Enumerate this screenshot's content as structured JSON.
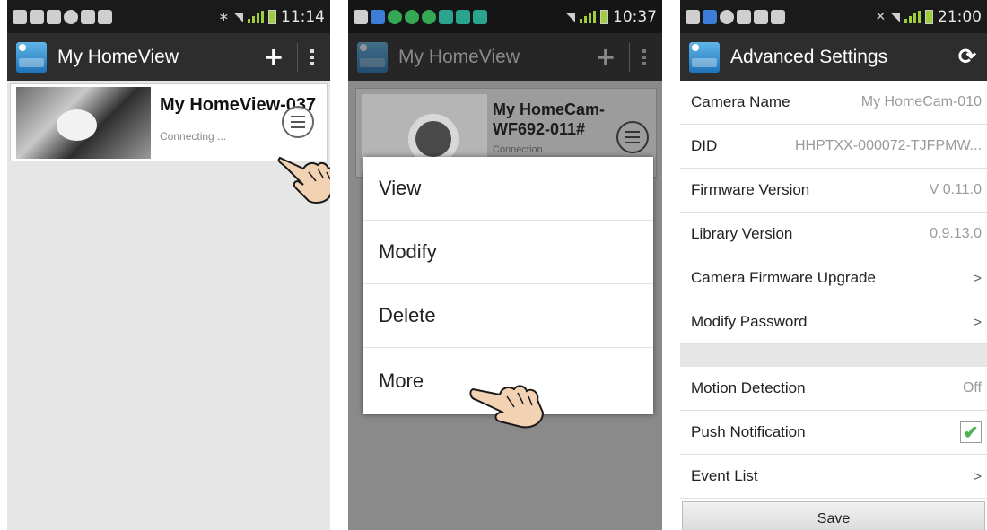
{
  "panel1": {
    "status_time": "11:14",
    "title": "My HomeView",
    "camera": {
      "name": "My HomeView-037",
      "status": "Connecting ..."
    }
  },
  "panel2": {
    "status_time": "10:37",
    "title": "My HomeView",
    "camera": {
      "name": "My HomeCam-\nWF692-011#",
      "status": "Connection"
    },
    "menu": [
      "View",
      "Modify",
      "Delete",
      "More"
    ]
  },
  "panel3": {
    "status_time": "21:00",
    "title": "Advanced Settings",
    "rows": [
      {
        "label": "Camera Name",
        "value": "My HomeCam-010"
      },
      {
        "label": "DID",
        "value": "HHPTXX-000072-TJFPMW..."
      },
      {
        "label": "Firmware Version",
        "value": "V 0.11.0"
      },
      {
        "label": "Library Version",
        "value": "0.9.13.0"
      },
      {
        "label": "Camera Firmware Upgrade",
        "value": ">"
      },
      {
        "label": "Modify Password",
        "value": ">"
      }
    ],
    "rows2": [
      {
        "label": "Motion Detection",
        "value": "Off"
      },
      {
        "label": "Push Notification",
        "value": "✔"
      },
      {
        "label": "Event List",
        "value": ">"
      }
    ],
    "save_label": "Save"
  },
  "colors": {
    "actionbar": "#2d2d2d",
    "statusbar": "#1a1a1a",
    "checkmark": "#4caf50"
  },
  "icons": [
    "add-icon",
    "overflow-menu-icon",
    "refresh-icon",
    "hamburger-menu-icon",
    "pointing-hand-icon",
    "checkbox-checked-icon",
    "chevron-right-icon"
  ]
}
